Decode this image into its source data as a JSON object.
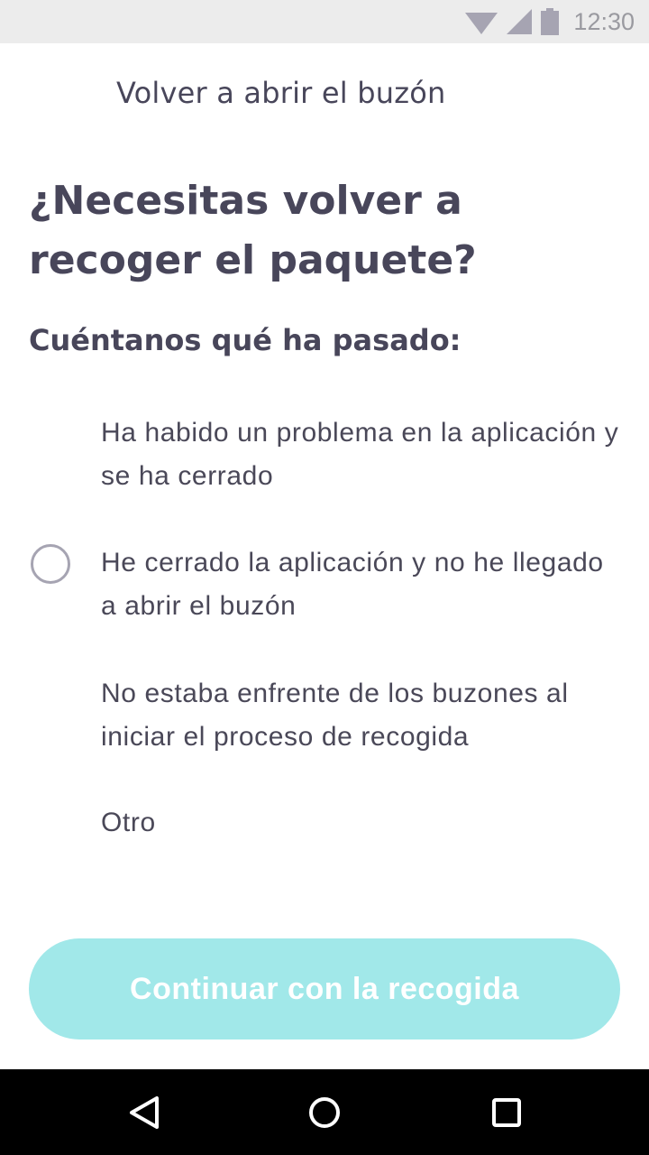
{
  "status_bar": {
    "time": "12:30",
    "icons": [
      "wifi-icon",
      "cell-signal-icon",
      "battery-icon"
    ]
  },
  "header": {
    "title": "Volver a abrir el buzón"
  },
  "main": {
    "question": "¿Necesitas volver a recoger el paquete?",
    "subtitle": "Cuéntanos qué ha pasado:",
    "options": [
      {
        "label": "Ha habido un problema en la aplicación y se ha cerrado",
        "radio_visible": false
      },
      {
        "label": "He cerrado la aplicación y no he llegado a abrir el buzón",
        "radio_visible": true,
        "selected": false
      },
      {
        "label": "No estaba enfrente de los buzones al iniciar el proceso de recogida",
        "radio_visible": false
      },
      {
        "label": "Otro",
        "radio_visible": false
      }
    ]
  },
  "footer": {
    "continue_label": "Continuar con la recogida",
    "continue_color": "#a1e8e9"
  },
  "nav_bar": {
    "buttons": [
      "back-icon",
      "home-icon",
      "recents-icon"
    ]
  },
  "colors": {
    "text_primary": "#48465a",
    "radio_border": "#a6a4b2",
    "status_bar_bg": "#ececec"
  }
}
